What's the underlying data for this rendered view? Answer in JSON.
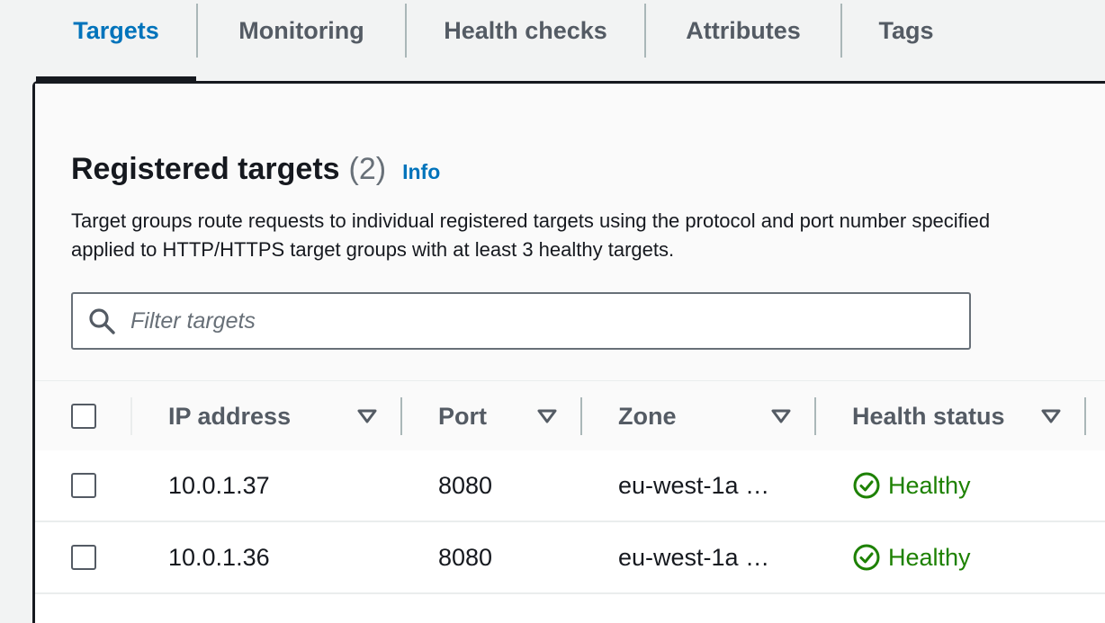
{
  "tabs": [
    {
      "label": "Targets",
      "active": true
    },
    {
      "label": "Monitoring",
      "active": false
    },
    {
      "label": "Health checks",
      "active": false
    },
    {
      "label": "Attributes",
      "active": false
    },
    {
      "label": "Tags",
      "active": false
    }
  ],
  "panel": {
    "title": "Registered targets",
    "count": "(2)",
    "info_link": "Info",
    "description_line1": "Target groups route requests to individual registered targets using the protocol and port number specified",
    "description_line2": "applied to HTTP/HTTPS target groups with at least 3 healthy targets.",
    "search_placeholder": "Filter targets"
  },
  "table": {
    "columns": [
      "IP address",
      "Port",
      "Zone",
      "Health status"
    ],
    "rows": [
      {
        "ip": "10.0.1.37",
        "port": "8080",
        "zone": "eu-west-1a …",
        "health": "Healthy"
      },
      {
        "ip": "10.0.1.36",
        "port": "8080",
        "zone": "eu-west-1a …",
        "health": "Healthy"
      }
    ]
  },
  "colors": {
    "accent": "#0073bb",
    "healthy": "#1d8102",
    "text": "#16191f",
    "muted": "#545b64"
  }
}
